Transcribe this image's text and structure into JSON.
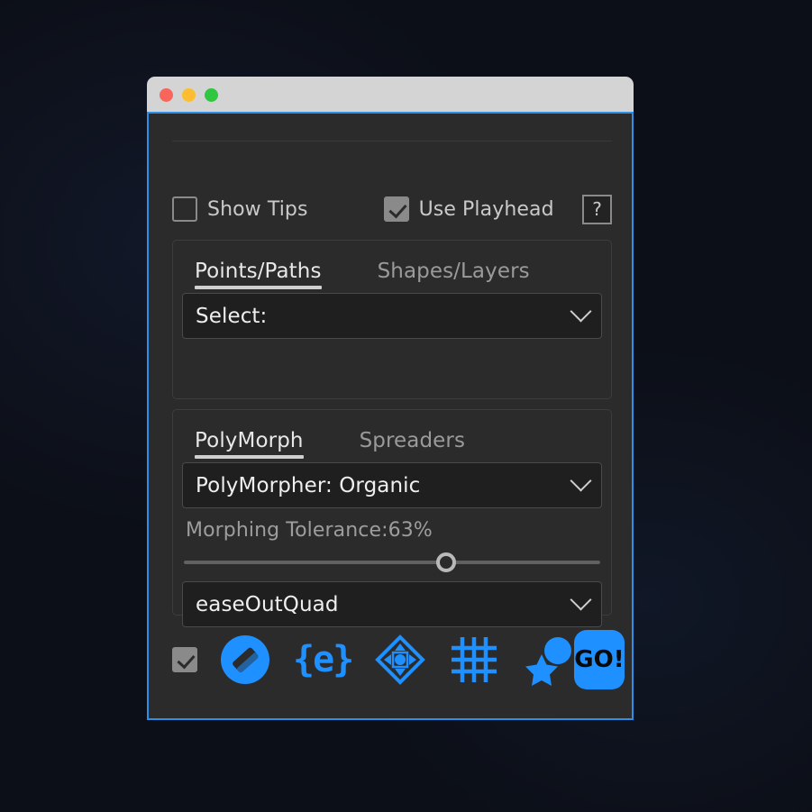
{
  "window": {
    "traffic_lights": [
      {
        "name": "close",
        "color": "#f9655b"
      },
      {
        "name": "minimize",
        "color": "#fdbd2e"
      },
      {
        "name": "zoom",
        "color": "#2fc640"
      }
    ],
    "accent_color": "#1e90ff",
    "border_color": "#2e8fe8",
    "panel_bg": "#2b2b2b"
  },
  "options": {
    "show_tips": {
      "label": "Show Tips",
      "checked": false
    },
    "use_playhead": {
      "label": "Use Playhead",
      "checked": true
    },
    "help_label": "?"
  },
  "section_one": {
    "tabs": [
      {
        "label": "Points/Paths",
        "active": true
      },
      {
        "label": "Shapes/Layers",
        "active": false
      }
    ],
    "select": {
      "value": "Select:",
      "icon": "chevron-down-icon"
    }
  },
  "section_two": {
    "tabs": [
      {
        "label": "PolyMorph",
        "active": true
      },
      {
        "label": "Spreaders",
        "active": false
      }
    ],
    "morpher_select": {
      "value": "PolyMorpher: Organic",
      "icon": "chevron-down-icon"
    },
    "tolerance": {
      "label": "Morphing Tolerance:63%",
      "value": 63,
      "min": 0,
      "max": 100
    },
    "easing_select": {
      "value": "easeOutQuad",
      "icon": "chevron-down-icon"
    }
  },
  "toolbar": {
    "enable_checkbox": {
      "name": "toolbar-enable-checkbox",
      "checked": true
    },
    "items": [
      {
        "name": "eraser-icon",
        "label": "Eraser"
      },
      {
        "name": "expression-icon",
        "label": "{e}"
      },
      {
        "name": "transform-icon",
        "label": "Transform"
      },
      {
        "name": "grid-icon",
        "label": "Grid"
      },
      {
        "name": "star-shape-icon",
        "label": "Shapes"
      }
    ],
    "go_button": {
      "label": "GO!"
    }
  }
}
